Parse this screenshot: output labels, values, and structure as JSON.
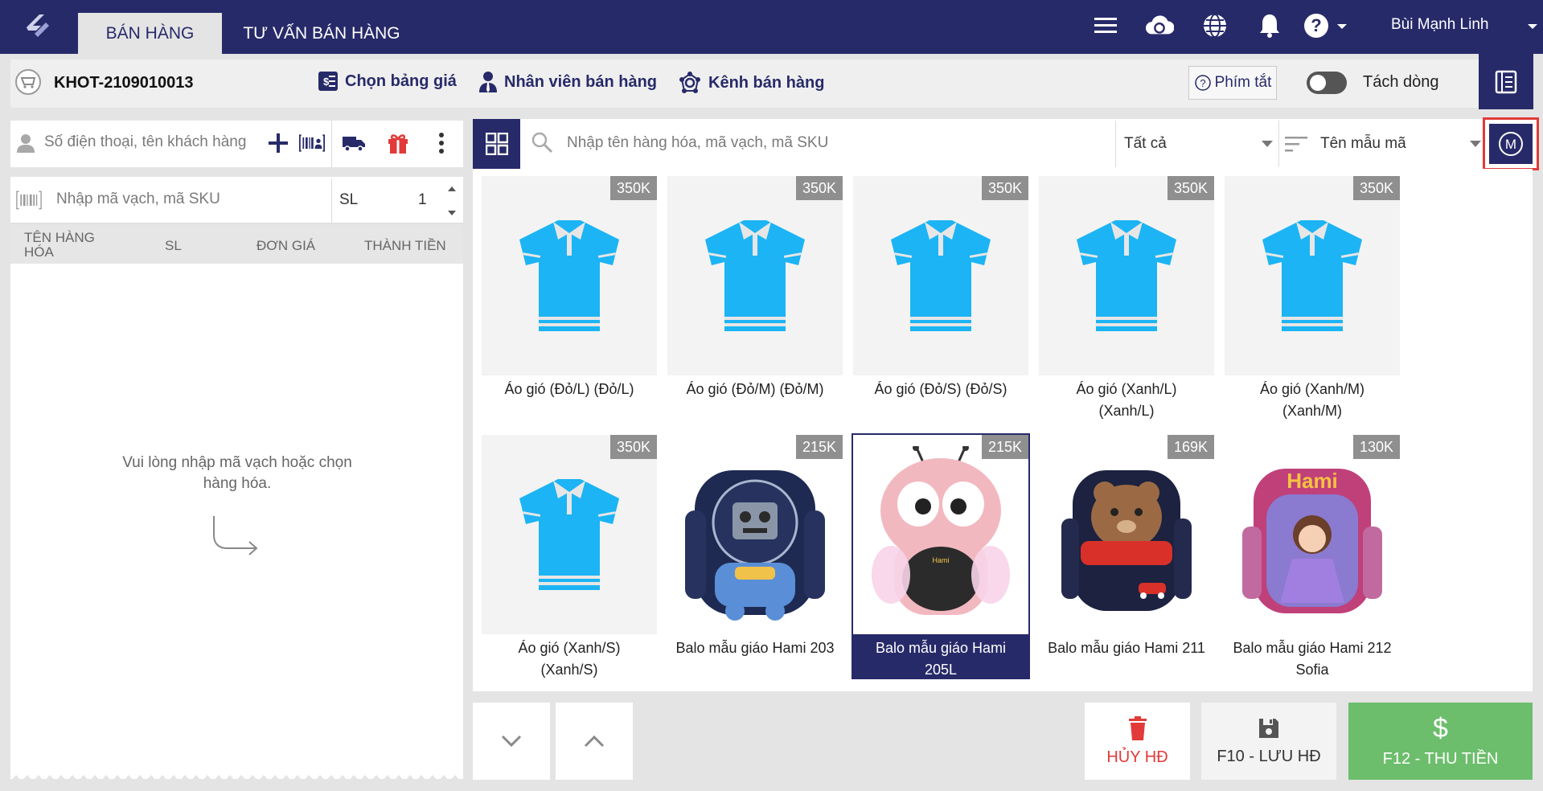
{
  "header": {
    "tabs": [
      {
        "label": "BÁN HÀNG",
        "active": true
      },
      {
        "label": "TƯ VẤN BÁN HÀNG",
        "active": false
      }
    ],
    "icons": [
      "menu-icon",
      "cloud-sync-icon",
      "globe-icon",
      "bell-icon",
      "help-icon"
    ],
    "user_name": "Bùi Mạnh Linh",
    "colors": {
      "brand": "#272a69",
      "accent_red": "#e23a3a",
      "pay_green": "#6cbe6c"
    }
  },
  "toolbar": {
    "order_code": "KHOT-2109010013",
    "price_list_label": "Chọn bảng giá",
    "staff_label": "Nhân viên bán hàng",
    "channel_label": "Kênh bán hàng",
    "hotkey_label": "Phím tắt",
    "split_line_label": "Tách dòng"
  },
  "customer": {
    "placeholder": "Số điện thoại, tên khách hàng"
  },
  "sku": {
    "placeholder": "Nhập mã vạch, mã SKU",
    "qty_label": "SL",
    "qty_value": "1"
  },
  "cart_table": {
    "col_name_line1": "TÊN HÀNG",
    "col_name_line2": "HÓA",
    "col_qty": "SL",
    "col_price": "ĐƠN GIÁ",
    "col_total": "THÀNH TIỀN",
    "empty_line1": "Vui lòng nhập mã vạch hoặc chọn",
    "empty_line2": "hàng hóa."
  },
  "product_search": {
    "placeholder": "Nhập tên hàng hóa, mã vạch, mã SKU",
    "category_value": "Tất cả",
    "sort_value": "Tên mẫu mã",
    "mode_label": "M"
  },
  "products": [
    {
      "name1": "Áo gió (Đỏ/L) (Đỏ/L)",
      "name2": "",
      "price": "350K",
      "image": "shirt"
    },
    {
      "name1": "Áo gió (Đỏ/M) (Đỏ/M)",
      "name2": "",
      "price": "350K",
      "image": "shirt"
    },
    {
      "name1": "Áo gió (Đỏ/S) (Đỏ/S)",
      "name2": "",
      "price": "350K",
      "image": "shirt"
    },
    {
      "name1": "Áo gió (Xanh/L)",
      "name2": "(Xanh/L)",
      "price": "350K",
      "image": "shirt"
    },
    {
      "name1": "Áo gió (Xanh/M)",
      "name2": "(Xanh/M)",
      "price": "350K",
      "image": "shirt"
    },
    {
      "name1": "Áo gió (Xanh/S)",
      "name2": "(Xanh/S)",
      "price": "350K",
      "image": "shirt"
    },
    {
      "name1": "Balo mẫu giáo Hami 203",
      "name2": "",
      "price": "215K",
      "image": "robot-backpack"
    },
    {
      "name1": "Balo mẫu giáo Hami",
      "name2": "205L",
      "price": "215K",
      "image": "bee-backpack",
      "selected": true
    },
    {
      "name1": "Balo mẫu giáo Hami 211",
      "name2": "",
      "price": "169K",
      "image": "bear-backpack"
    },
    {
      "name1": "Balo mẫu giáo Hami 212",
      "name2": "Sofia",
      "price": "130K",
      "image": "sofia-backpack",
      "brand_text": "Hami"
    }
  ],
  "actions": {
    "cancel_label": "HỦY HĐ",
    "save_label": "F10 - LƯU HĐ",
    "pay_label": "F12 - THU TIỀN"
  }
}
